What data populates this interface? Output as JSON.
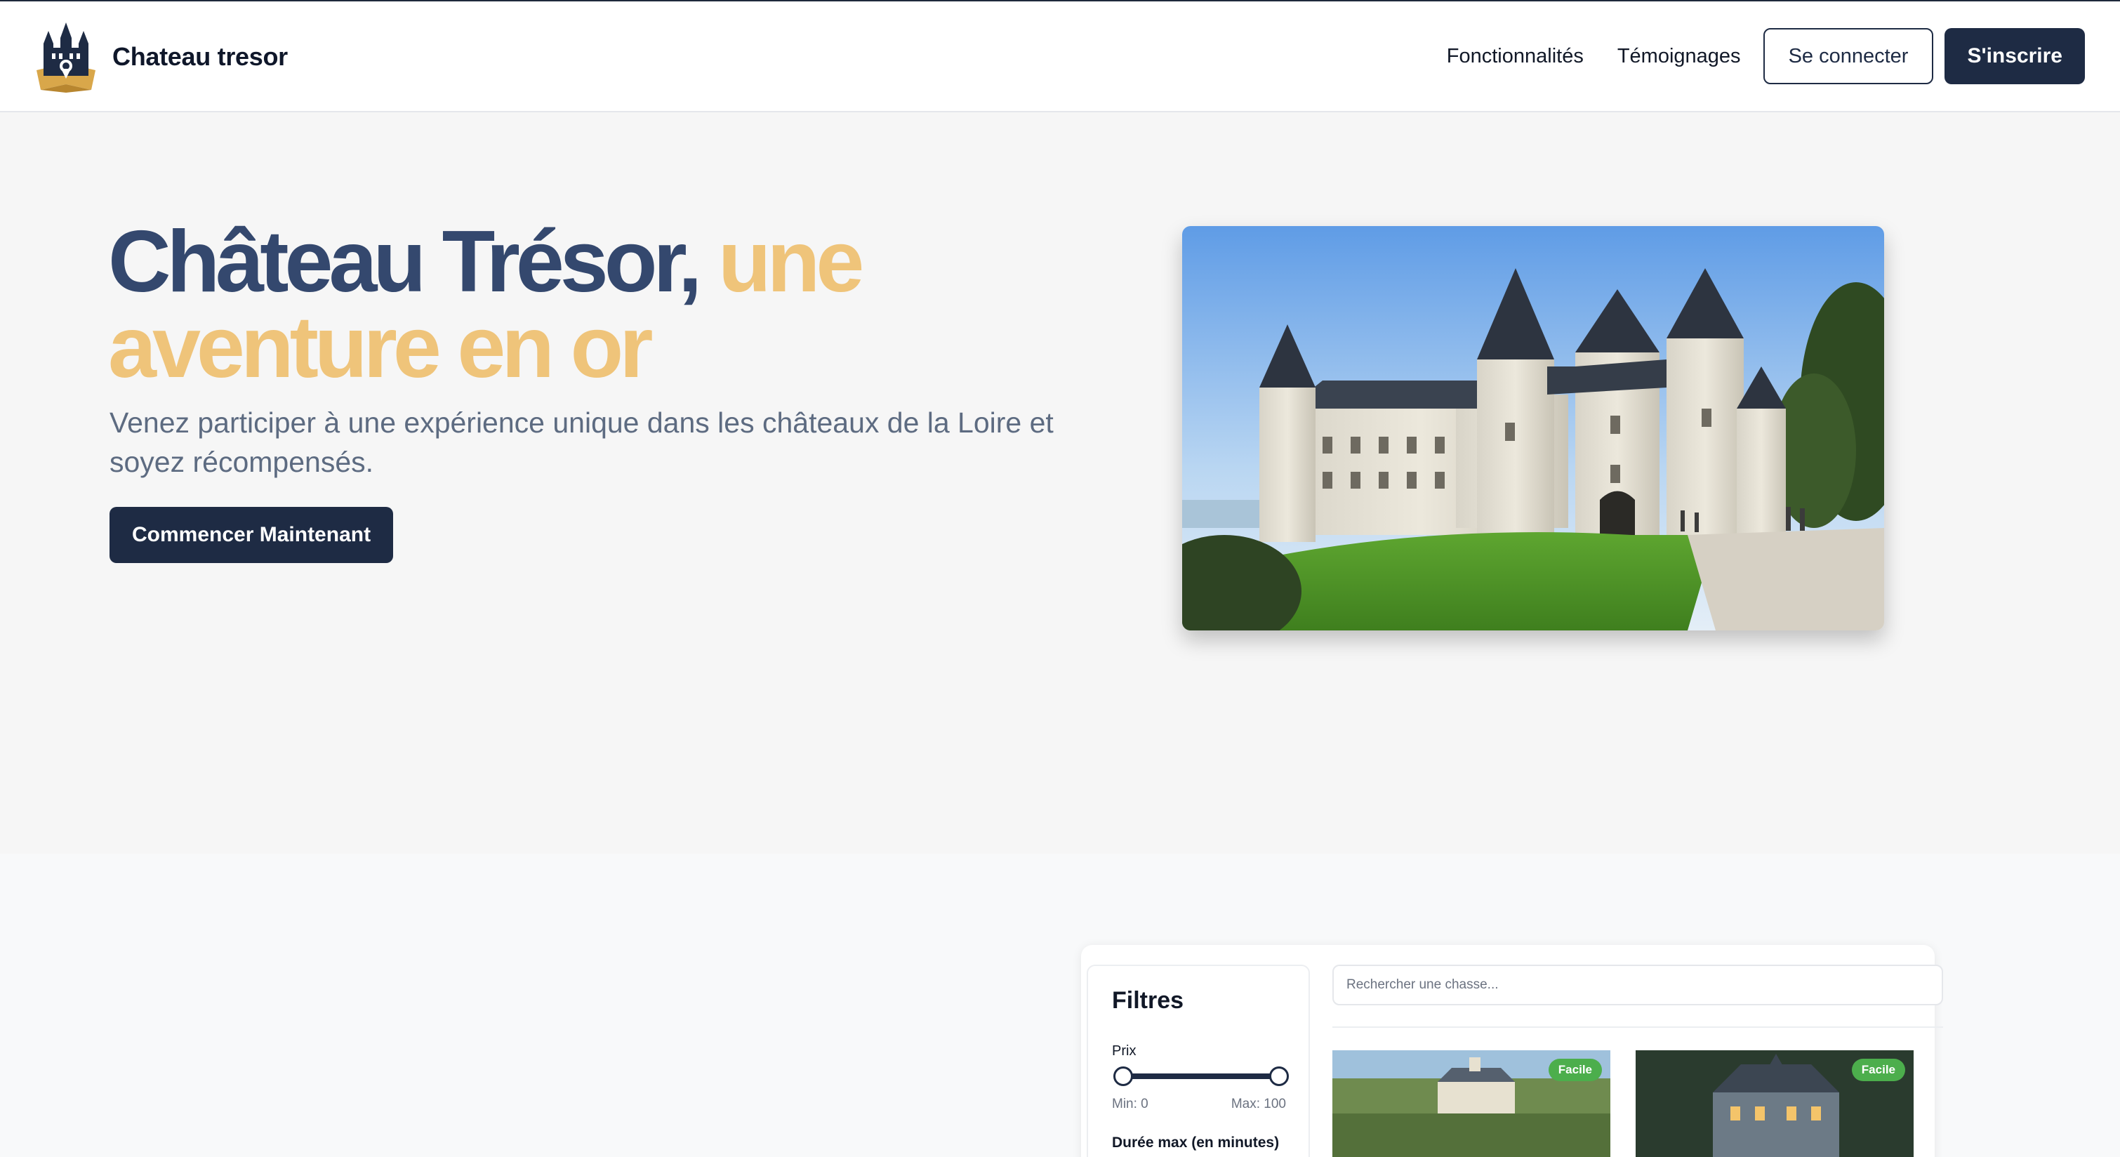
{
  "navbar": {
    "brand_name": "Chateau tresor",
    "links": [
      "Fonctionnalités",
      "Témoignages"
    ],
    "login_label": "Se connecter",
    "signup_label": "S'inscrire"
  },
  "hero": {
    "title_dark": "Château Trésor, ",
    "title_gold": "une aventure en or",
    "subtitle": "Venez participer à une expérience unique dans les châteaux de la Loire et soyez récompensés.",
    "cta_label": "Commencer Maintenant"
  },
  "preview": {
    "filters_title": "Filtres",
    "price_label": "Prix",
    "price_min": "Min: 0",
    "price_max": "Max: 100",
    "duration_label": "Durée max (en minutes)",
    "search_placeholder": "Rechercher une chasse...",
    "cards": [
      {
        "badge": "Facile"
      },
      {
        "badge": "Facile"
      }
    ]
  },
  "colors": {
    "navy": "#1e2b44",
    "title_blue": "#34486e",
    "gold": "#efc47a",
    "badge_green": "#4cae4c"
  }
}
